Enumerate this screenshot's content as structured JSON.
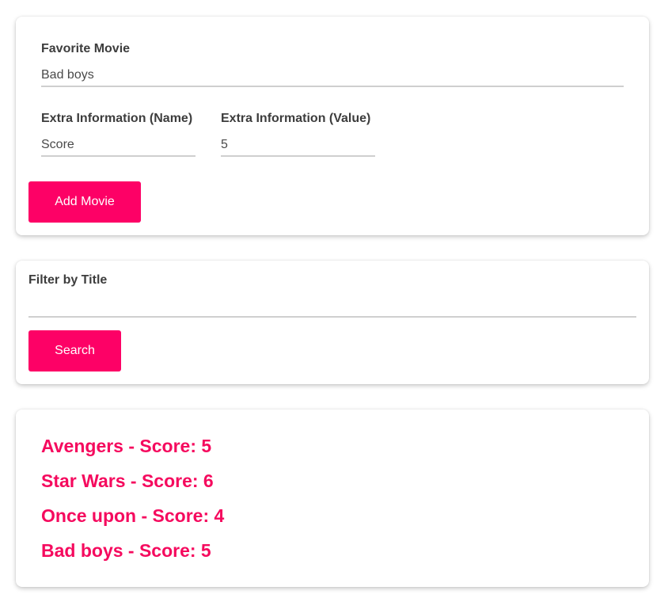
{
  "add_form": {
    "title_label": "Favorite Movie",
    "title_value": "Bad boys",
    "extra_name_label": "Extra Information (Name)",
    "extra_name_value": "Score",
    "extra_value_label": "Extra Information (Value)",
    "extra_value_value": "5",
    "add_button_label": "Add Movie"
  },
  "filter": {
    "label": "Filter by Title",
    "value": "",
    "search_button_label": "Search"
  },
  "movies": [
    "Avengers - Score: 5",
    "Star Wars - Score: 6",
    "Once upon - Score: 4",
    "Bad boys - Score: 5"
  ],
  "colors": {
    "accent": "#fd0166",
    "movie_text": "#f50a5e"
  }
}
